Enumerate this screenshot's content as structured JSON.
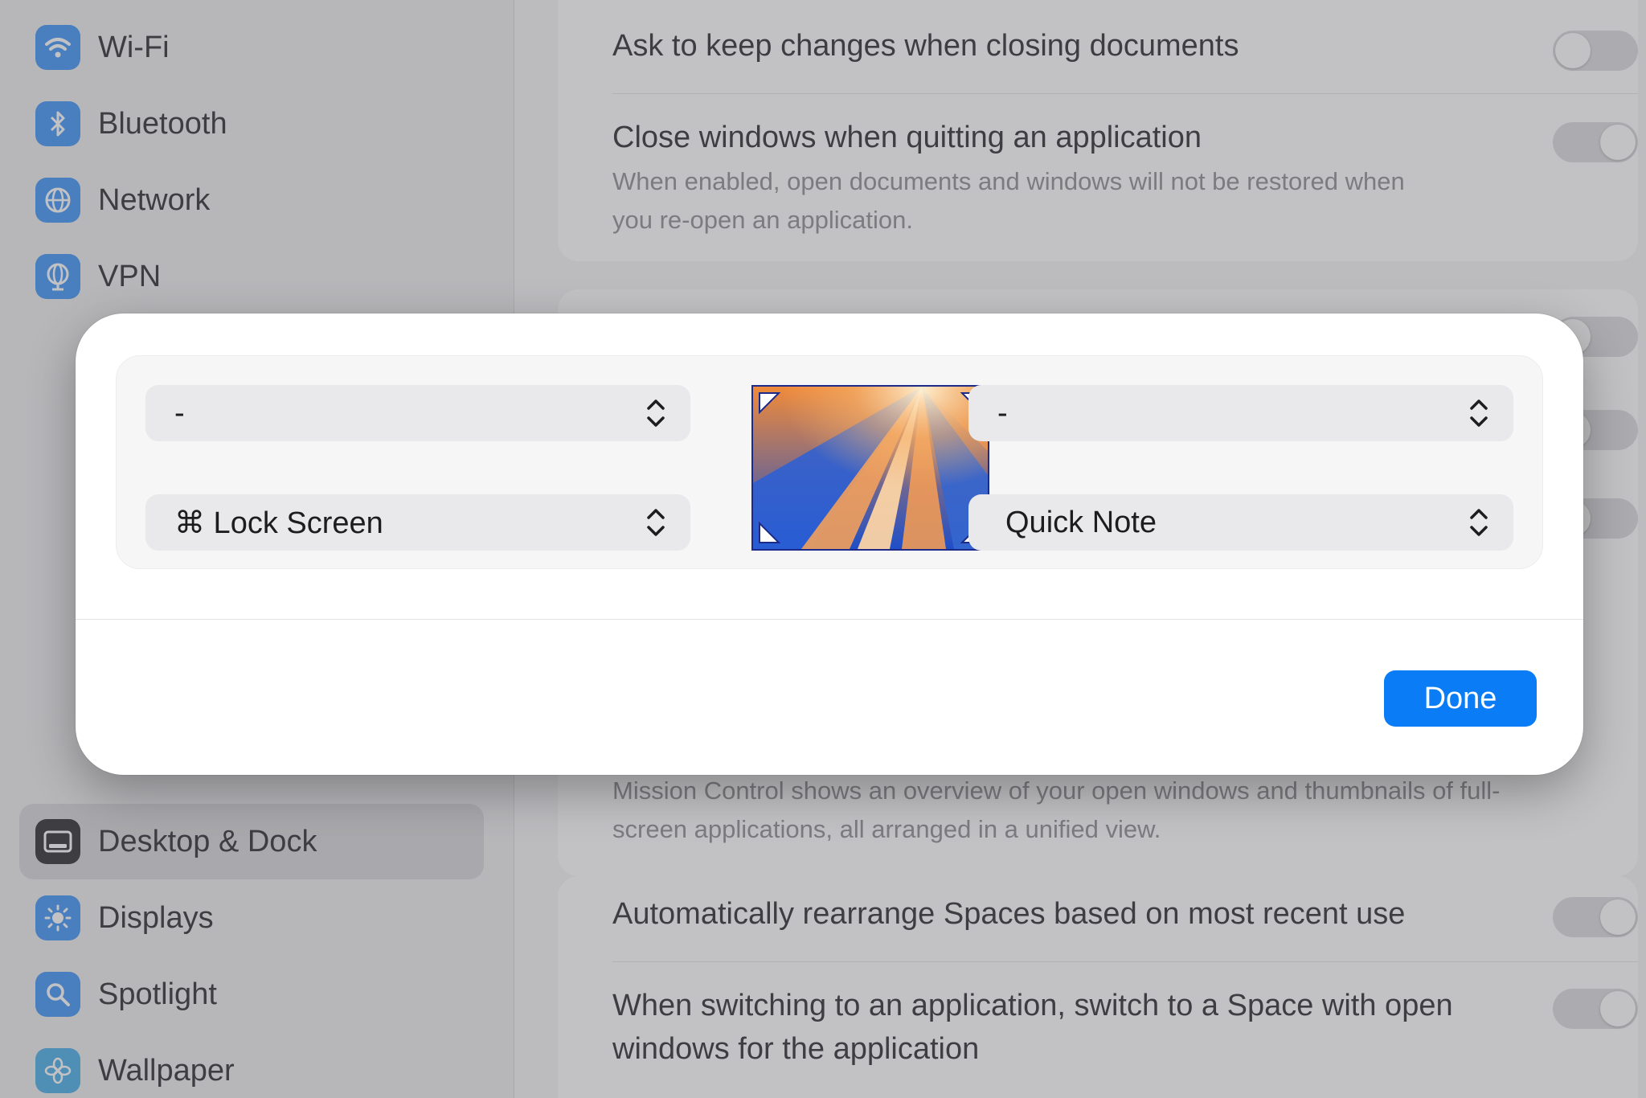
{
  "sidebar": {
    "items": [
      {
        "label": "Wi-Fi",
        "icon": "wifi-icon",
        "color": "#2f8cf5"
      },
      {
        "label": "Bluetooth",
        "icon": "bluetooth-icon",
        "color": "#2f8cf5"
      },
      {
        "label": "Network",
        "icon": "globe-icon",
        "color": "#2f8cf5"
      },
      {
        "label": "VPN",
        "icon": "vpn-globe-icon",
        "color": "#2f8cf5"
      },
      {
        "label": "Desktop & Dock",
        "icon": "dock-icon",
        "color": "#1d1d1f",
        "selected": true
      },
      {
        "label": "Displays",
        "icon": "sun-icon",
        "color": "#2f8cf5"
      },
      {
        "label": "Spotlight",
        "icon": "magnifier-icon",
        "color": "#2f8cf5"
      },
      {
        "label": "Wallpaper",
        "icon": "flower-icon",
        "color": "#3aa5e6"
      }
    ]
  },
  "settings": {
    "ask_keep_changes": "Ask to keep changes when closing documents",
    "close_windows_title": "Close windows when quitting an application",
    "close_windows_desc_line1": "When enabled, open documents and windows will not be restored when",
    "close_windows_desc_line2": "you re-open an application.",
    "mission_control_desc_line1": "Mission Control shows an overview of your open windows and thumbnails of full-",
    "mission_control_desc_line2": "screen applications, all arranged in a unified view.",
    "rearrange_spaces": "Automatically rearrange Spaces based on most recent use",
    "switch_space_line1": "When switching to an application, switch to a Space with open",
    "switch_space_line2": "windows for the application"
  },
  "hot_corners": {
    "top_left": "-",
    "top_right": "-",
    "bottom_left": "⌘ Lock Screen",
    "bottom_right": "Quick Note"
  },
  "sheet": {
    "done_label": "Done"
  },
  "colors": {
    "accent": "#0a7cf5",
    "preview_border": "#1c2a8a"
  }
}
